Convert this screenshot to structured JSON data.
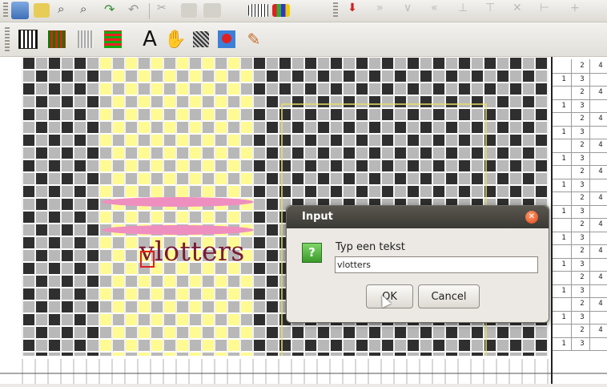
{
  "toolbar_top": {
    "icons": [
      "new-file",
      "open-folder",
      "zoom-in",
      "zoom-out",
      "redo",
      "undo",
      "cut",
      "copy",
      "paste",
      "grid-view",
      "color-palette",
      "insert-down",
      "cross-1",
      "cross-2",
      "cross-3",
      "cross-4",
      "cross-5",
      "cross-6",
      "cross-7",
      "cross-8"
    ]
  },
  "toolbar_tools": {
    "text_tool_label": "A",
    "icons": [
      "grid-tool",
      "colored-grid-tool",
      "pattern-tool",
      "fill-grid-tool",
      "text-tool",
      "hand-tool",
      "texture-tool",
      "color-fill-tool",
      "pencil-tool"
    ]
  },
  "canvas": {
    "text_overlay": "vlotters",
    "colors": {
      "dark": "#2f2f2f",
      "gray": "#b8b8b8",
      "yellow": "#fffa92",
      "pink": "#ef8fc0",
      "text": "#7a1a34",
      "selection_red": "#e02020"
    }
  },
  "right_panel": {
    "rows": [
      [
        "",
        "2",
        "4"
      ],
      [
        "1",
        "3",
        ""
      ],
      [
        "",
        "2",
        "4"
      ],
      [
        "1",
        "3",
        ""
      ],
      [
        "",
        "2",
        "4"
      ],
      [
        "1",
        "3",
        ""
      ],
      [
        "",
        "2",
        "4"
      ],
      [
        "1",
        "3",
        ""
      ],
      [
        "",
        "2",
        "4"
      ],
      [
        "1",
        "3",
        ""
      ],
      [
        "",
        "2",
        "4"
      ],
      [
        "1",
        "3",
        ""
      ],
      [
        "",
        "2",
        "4"
      ],
      [
        "1",
        "3",
        ""
      ],
      [
        "",
        "2",
        "4"
      ],
      [
        "1",
        "3",
        ""
      ],
      [
        "",
        "2",
        "4"
      ],
      [
        "1",
        "3",
        ""
      ],
      [
        "",
        "2",
        "4"
      ],
      [
        "1",
        "3",
        ""
      ],
      [
        "",
        "2",
        "4"
      ],
      [
        "1",
        "3",
        ""
      ]
    ]
  },
  "dialog": {
    "title": "Input",
    "prompt": "Typ een tekst",
    "value": "vlotters",
    "ok_label": "OK",
    "cancel_label": "Cancel",
    "question_symbol": "?"
  }
}
